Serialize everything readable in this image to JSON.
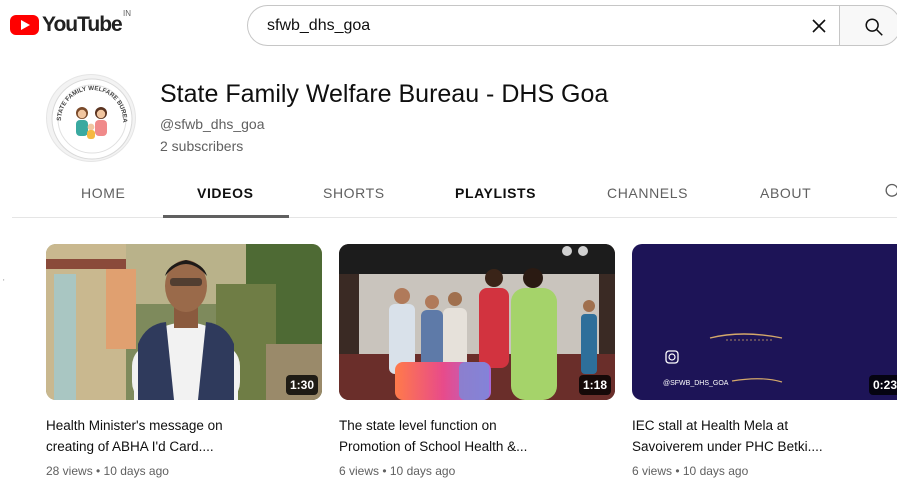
{
  "header": {
    "logo_text": "YouTube",
    "country_code": "IN",
    "search_value": "sfwb_dhs_goa",
    "clear_icon": "close-icon",
    "search_icon": "search-icon"
  },
  "channel": {
    "name": "State Family Welfare Bureau - DHS Goa",
    "handle": "@sfwb_dhs_goa",
    "subscribers": "2 subscribers",
    "avatar_text": "STATE FAMILY WELFARE BUREAU"
  },
  "tabs": [
    {
      "label": "HOME"
    },
    {
      "label": "VIDEOS"
    },
    {
      "label": "SHORTS"
    },
    {
      "label": "PLAYLISTS"
    },
    {
      "label": "CHANNELS"
    },
    {
      "label": "ABOUT"
    }
  ],
  "videos": [
    {
      "title_line1": "Health Minister's message on",
      "title_line2": "creating of ABHA I'd Card....",
      "meta": "28 views • 10 days ago",
      "duration": "1:30"
    },
    {
      "title_line1": "The state level function on",
      "title_line2": "Promotion of School Health &...",
      "meta": "6 views • 10 days ago",
      "duration": "1:18"
    },
    {
      "title_line1": "IEC stall at Health Mela at",
      "title_line2": "Savoiverem under PHC Betki....",
      "meta": "6 views • 10 days ago",
      "duration": "0:23",
      "thumb_caption": "@SFWB_DHS_GOA"
    }
  ],
  "colors": {
    "brand_red": "#ff0000",
    "text_primary": "#0f0f0f",
    "text_secondary": "#606060",
    "thumb3_bg": "#1d1457"
  }
}
